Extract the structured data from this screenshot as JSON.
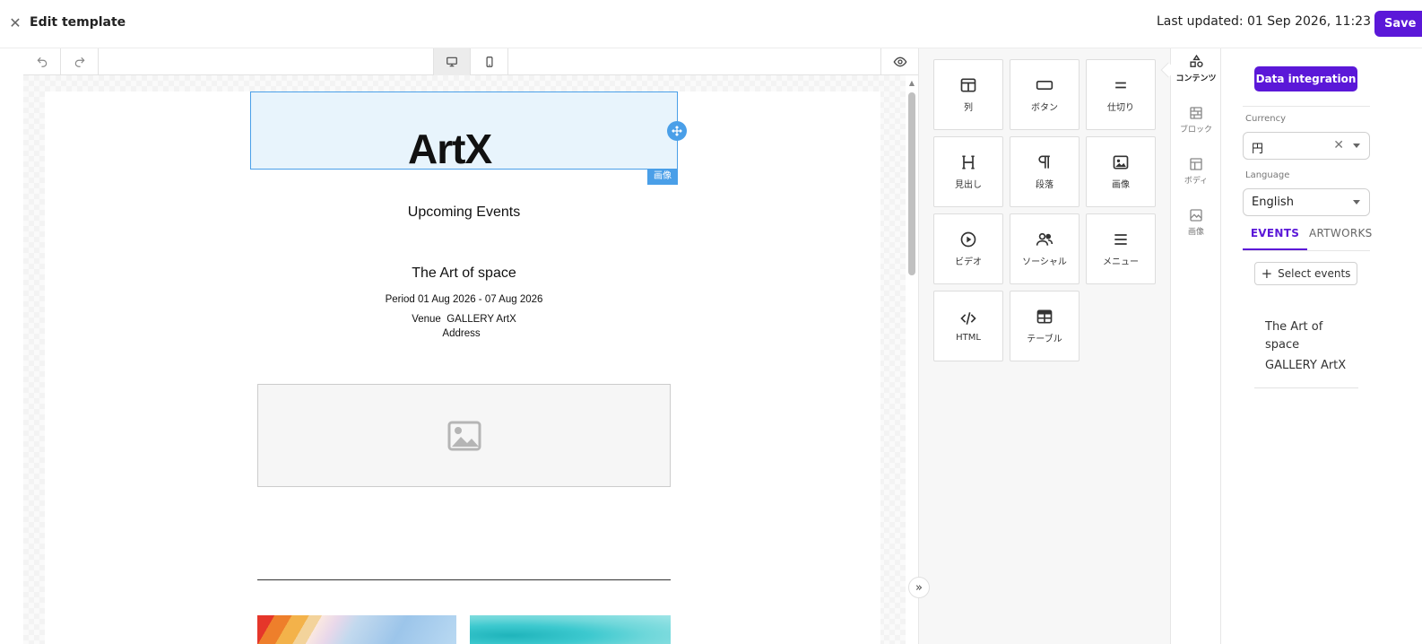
{
  "header": {
    "title": "Edit template",
    "last_updated": "Last updated: 01 Sep 2026, 11:23",
    "save_label": "Save"
  },
  "canvas": {
    "image_tag": "画像",
    "logo_text": "ArtX",
    "heading": "Upcoming Events",
    "event": {
      "title": "The Art of space",
      "period_label": "Period",
      "period": "01 Aug 2026 - 07 Aug 2026",
      "venue_label": "Venue",
      "venue": "GALLERY ArtX",
      "address_label": "Address"
    }
  },
  "tools": [
    {
      "label": "列",
      "icon": "columns-icon"
    },
    {
      "label": "ボタン",
      "icon": "button-icon"
    },
    {
      "label": "仕切り",
      "icon": "divider-icon"
    },
    {
      "label": "見出し",
      "icon": "heading-icon"
    },
    {
      "label": "段落",
      "icon": "paragraph-icon"
    },
    {
      "label": "画像",
      "icon": "image-icon"
    },
    {
      "label": "ビデオ",
      "icon": "video-icon"
    },
    {
      "label": "ソーシャル",
      "icon": "social-icon"
    },
    {
      "label": "メニュー",
      "icon": "menu-icon"
    },
    {
      "label": "HTML",
      "icon": "code-icon"
    },
    {
      "label": "テーブル",
      "icon": "table-icon"
    }
  ],
  "side_tabs": [
    {
      "label": "コンテンツ",
      "icon": "shapes-icon",
      "active": true
    },
    {
      "label": "ブロック",
      "icon": "blocks-icon",
      "active": false
    },
    {
      "label": "ボディ",
      "icon": "layout-icon",
      "active": false
    },
    {
      "label": "画像",
      "icon": "images-icon",
      "active": false
    }
  ],
  "right_panel": {
    "data_integration_label": "Data integration",
    "currency_label": "Currency",
    "currency_value": "円",
    "language_label": "Language",
    "language_value": "English",
    "tabs": [
      "EVENTS",
      "ARTWORKS"
    ],
    "select_events_label": "Select events",
    "selected_event": {
      "name": "The Art of space",
      "venue": "GALLERY ArtX"
    }
  },
  "colors": {
    "accent": "#5b18d8",
    "selection": "#4a9fe8"
  }
}
